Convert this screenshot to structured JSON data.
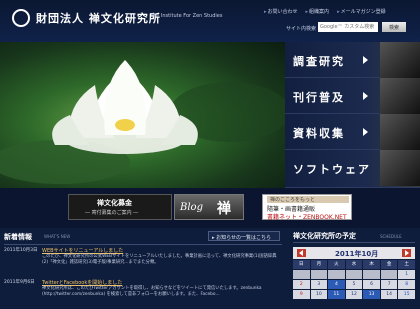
{
  "header": {
    "logo_text": "財団法人 禅文化研究所",
    "logo_sub": "The Institute For Zen Studies",
    "links": [
      "お問い合わせ",
      "組織案内",
      "メールマガジン登録"
    ],
    "search_label": "サイト内検索",
    "search_placeholder": "Google™ カスタム検索",
    "search_button": "検索"
  },
  "menu": {
    "items": [
      {
        "label": "調査研究"
      },
      {
        "label": "刊行普及"
      },
      {
        "label": "資料収集"
      },
      {
        "label": "ソフトウェア"
      }
    ]
  },
  "banners": {
    "fund_title": "禅文化募金",
    "fund_sub": "― 寄付募集のご案内 ―",
    "blog_label": "Blog",
    "blog_kanji": "禅",
    "shop_top": "禅のこころをもっと",
    "shop_mid": "隨筆・画書籍通販",
    "shop_bot": "書籍ネット・ZENBOOK.NET"
  },
  "news": {
    "title": "新着情報",
    "subtitle": "WHAT'S NEW",
    "list_button": "お知らせの一覧はこちら",
    "items": [
      {
        "date": "2011年10月3日",
        "headline": "WEBサイトをリニューアルしました",
        "body": "このたび、禅文化研究所の公式WEBサイトをリニューアルいたしました。事業計画に沿って、禅文化研究事業(1)国語辞典(2)「禅文化」雑誌研究(3)電子版/事業研究...までまた分類。"
      },
      {
        "date": "2011年9月6日",
        "headline": "TwitterとFacebookを開始しました",
        "body": "禅文化研究所は、このたびTwitterアカウントを取得し、お知らせなどをツイートにて発信いたします。zenbunka (http://twitter.com/zenbunka) を検索して是非フォローをお願いします。また、Facebo..."
      }
    ]
  },
  "schedule": {
    "title": "禅文化研究所の予定",
    "subtitle": "SCHEDULE",
    "month_label": "2011年10月",
    "dow": [
      "日",
      "月",
      "火",
      "水",
      "木",
      "金",
      "土"
    ],
    "rows": [
      [
        "",
        "",
        "",
        "",
        "",
        "",
        "1"
      ],
      [
        "2",
        "3",
        "4",
        "5",
        "6",
        "7",
        "8"
      ],
      [
        "9",
        "10",
        "11",
        "12",
        "13",
        "14",
        "15"
      ]
    ],
    "event_days": [
      "4",
      "11",
      "13"
    ]
  }
}
